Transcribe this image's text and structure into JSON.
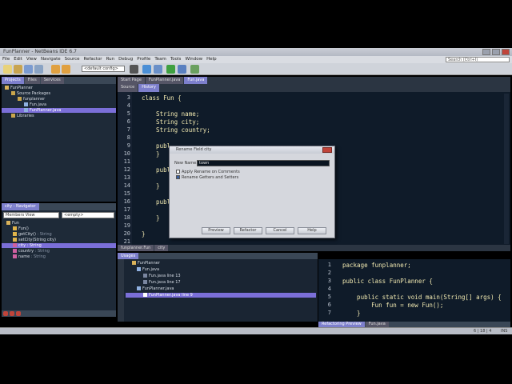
{
  "window": {
    "title": "FunPlanner - NetBeans IDE 6.7"
  },
  "menu": [
    "File",
    "Edit",
    "View",
    "Navigate",
    "Source",
    "Refactor",
    "Run",
    "Debug",
    "Profile",
    "Team",
    "Tools",
    "Window",
    "Help"
  ],
  "search": {
    "placeholder": "Search (Ctrl+I)"
  },
  "toolbar": {
    "config": "<default config>"
  },
  "projects_panel": {
    "tabs": [
      "Projects",
      "Files",
      "Services"
    ],
    "tree": [
      "FunPlanner",
      "Source Packages",
      "funplanner",
      "Fun.java",
      "FunPlanner.java",
      "Libraries"
    ]
  },
  "navigator_panel": {
    "tabs": [
      "city - Navigator"
    ],
    "filter": "Members View",
    "filter2": "<empty>",
    "tree": [
      {
        "name": "Fun",
        "type": ""
      },
      {
        "name": "Fun()",
        "type": ""
      },
      {
        "name": "getCity()",
        "type": " : String"
      },
      {
        "name": "setCity(String city)",
        "type": ""
      },
      {
        "name": "city",
        "type": " : String"
      },
      {
        "name": "country",
        "type": " : String"
      },
      {
        "name": "name",
        "type": " : String"
      }
    ]
  },
  "editor": {
    "tabs": [
      "Start Page",
      "FunPlanner.java",
      "Fun.java"
    ],
    "subtabs": [
      "Source",
      "History"
    ],
    "lines": [
      {
        "n": "3",
        "text": "class Fun {"
      },
      {
        "n": "4",
        "text": ""
      },
      {
        "n": "5",
        "text": "    String name;"
      },
      {
        "n": "6",
        "text": "    String city;"
      },
      {
        "n": "7",
        "text": "    String country;"
      },
      {
        "n": "8",
        "text": ""
      },
      {
        "n": "9",
        "text": "    publ"
      },
      {
        "n": "10",
        "text": "    }"
      },
      {
        "n": "11",
        "text": ""
      },
      {
        "n": "12",
        "text": "    publ"
      },
      {
        "n": "13",
        "text": ""
      },
      {
        "n": "14",
        "text": "    }"
      },
      {
        "n": "15",
        "text": ""
      },
      {
        "n": "16",
        "text": "    publ"
      },
      {
        "n": "17",
        "text": ""
      },
      {
        "n": "18",
        "text": "    }"
      },
      {
        "n": "19",
        "text": ""
      },
      {
        "n": "20",
        "text": "}"
      },
      {
        "n": "21",
        "text": ""
      }
    ],
    "breadcrumb": "funplanner.Fun",
    "breadcrumb2": "city"
  },
  "dialog": {
    "title": "Rename Field city",
    "new_name_label": "New Name:",
    "new_name_value": "town",
    "opt1": "Apply Rename on Comments",
    "opt2": "Rename Getters and Setters",
    "buttons": [
      "Preview",
      "Refactor",
      "Cancel",
      "Help"
    ]
  },
  "usages": {
    "tab": "Usages",
    "tree": [
      "FunPlanner",
      "Fun.java",
      "Fun.java line 13",
      "Fun.java line 17",
      "FunPlanner.java",
      "FunPlanner.java line 9"
    ]
  },
  "preview": {
    "lines": [
      {
        "n": "1",
        "text": "package funplanner;"
      },
      {
        "n": "2",
        "text": ""
      },
      {
        "n": "3",
        "text": "public class FunPlanner {"
      },
      {
        "n": "4",
        "text": ""
      },
      {
        "n": "5",
        "text": "    public static void main(String[] args) {"
      },
      {
        "n": "6",
        "text": "        Fun fun = new Fun();"
      },
      {
        "n": "7",
        "text": "    }"
      }
    ],
    "tabs": [
      "Refactoring Preview",
      "Fun.java"
    ]
  },
  "status": {
    "position": "6 | 18 | 4",
    "mode": "INS"
  }
}
